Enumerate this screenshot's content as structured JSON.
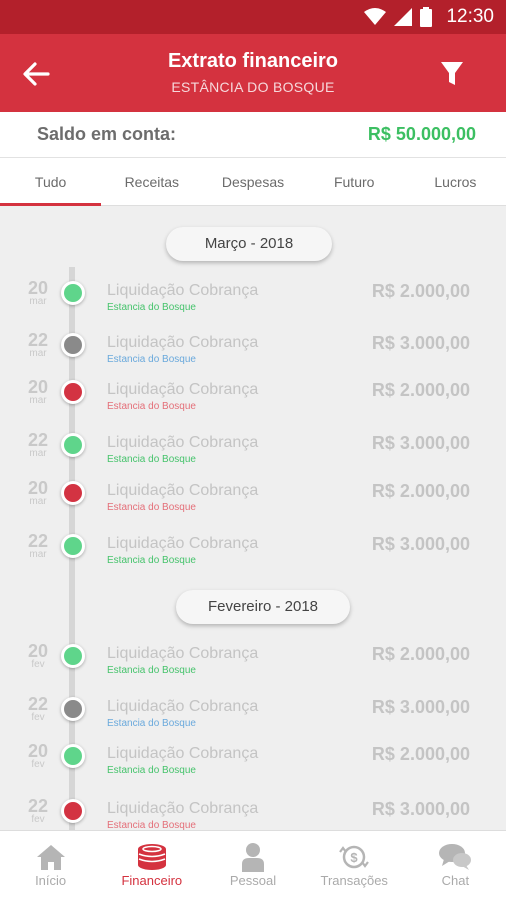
{
  "status_bar": {
    "time": "12:30",
    "icons": [
      "wifi-icon",
      "signal-icon",
      "battery-icon"
    ]
  },
  "app_bar": {
    "title": "Extrato financeiro",
    "subtitle": "ESTÂNCIA DO BOSQUE",
    "back_icon": "arrow-left-icon",
    "filter_icon": "filter-icon"
  },
  "balance": {
    "label": "Saldo em conta:",
    "amount": "R$ 50.000,00"
  },
  "tabs": [
    {
      "label": "Tudo",
      "active": true
    },
    {
      "label": "Receitas"
    },
    {
      "label": "Despesas"
    },
    {
      "label": "Futuro"
    },
    {
      "label": "Lucros"
    }
  ],
  "months": [
    {
      "label": "Março - 2018",
      "entries": [
        {
          "day": "20",
          "month": "mar",
          "description": "Liquidação Cobrança",
          "sub": "Estancia do Bosque",
          "value": "R$ 2.000,00",
          "status": "green"
        },
        {
          "day": "22",
          "month": "mar",
          "description": "Liquidação Cobrança",
          "sub": "Estancia do Bosque",
          "value": "R$ 3.000,00",
          "status": "gray"
        },
        {
          "day": "20",
          "month": "mar",
          "description": "Liquidação Cobrança",
          "sub": "Estancia do Bosque",
          "value": "R$ 2.000,00",
          "status": "red"
        },
        {
          "day": "22",
          "month": "mar",
          "description": "Liquidação Cobrança",
          "sub": "Estancia do Bosque",
          "value": "R$ 3.000,00",
          "status": "green"
        },
        {
          "day": "20",
          "month": "mar",
          "description": "Liquidação Cobrança",
          "sub": "Estancia do Bosque",
          "value": "R$ 2.000,00",
          "status": "red"
        },
        {
          "day": "22",
          "month": "mar",
          "description": "Liquidação Cobrança",
          "sub": "Estancia do Bosque",
          "value": "R$ 3.000,00",
          "status": "green"
        }
      ]
    },
    {
      "label": "Fevereiro - 2018",
      "entries": [
        {
          "day": "20",
          "month": "fev",
          "description": "Liquidação Cobrança",
          "sub": "Estancia do Bosque",
          "value": "R$ 2.000,00",
          "status": "green"
        },
        {
          "day": "22",
          "month": "fev",
          "description": "Liquidação Cobrança",
          "sub": "Estancia do Bosque",
          "value": "R$ 3.000,00",
          "status": "gray"
        },
        {
          "day": "20",
          "month": "fev",
          "description": "Liquidação Cobrança",
          "sub": "Estancia do Bosque",
          "value": "R$ 2.000,00",
          "status": "green"
        },
        {
          "day": "22",
          "month": "fev",
          "description": "Liquidação Cobrança",
          "sub": "Estancia do Bosque",
          "value": "R$ 3.000,00",
          "status": "red"
        }
      ]
    }
  ],
  "status_colors": {
    "green": "#5fd58b",
    "gray": "#8a8a8a",
    "red": "#d33342"
  },
  "sub_colors": {
    "green": "#46c36c",
    "gray": "#6aa9dc",
    "red": "#e46f79"
  },
  "bottom_nav": [
    {
      "label": "Início",
      "icon": "home-icon"
    },
    {
      "label": "Financeiro",
      "icon": "coins-icon",
      "active": true
    },
    {
      "label": "Pessoal",
      "icon": "person-icon"
    },
    {
      "label": "Transações",
      "icon": "money-transfer-icon"
    },
    {
      "label": "Chat",
      "icon": "chat-icon"
    }
  ]
}
